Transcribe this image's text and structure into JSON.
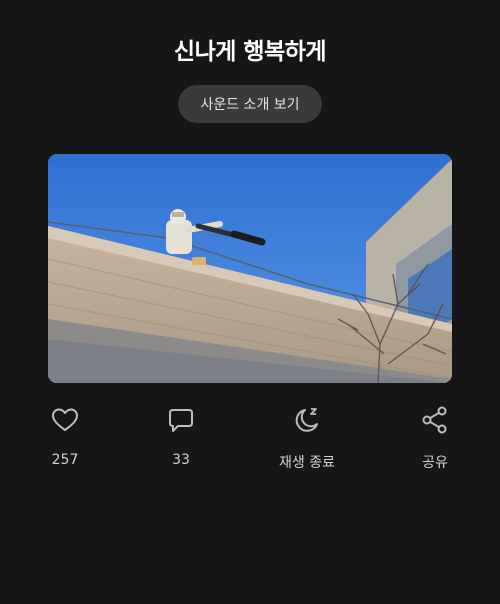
{
  "header": {
    "title": "신나게 행복하게",
    "intro_button_label": "사운드 소개 보기"
  },
  "actions": {
    "like_count": "257",
    "comment_count": "33",
    "sleep_label": "재생 종료",
    "share_label": "공유"
  },
  "icons": {
    "like": "heart-icon",
    "comment": "speech-bubble-icon",
    "sleep": "moon-zzz-icon",
    "share": "share-icon"
  },
  "colors": {
    "background": "#161616",
    "button_bg": "#3a3a3a",
    "icon": "#bdbdbd"
  }
}
